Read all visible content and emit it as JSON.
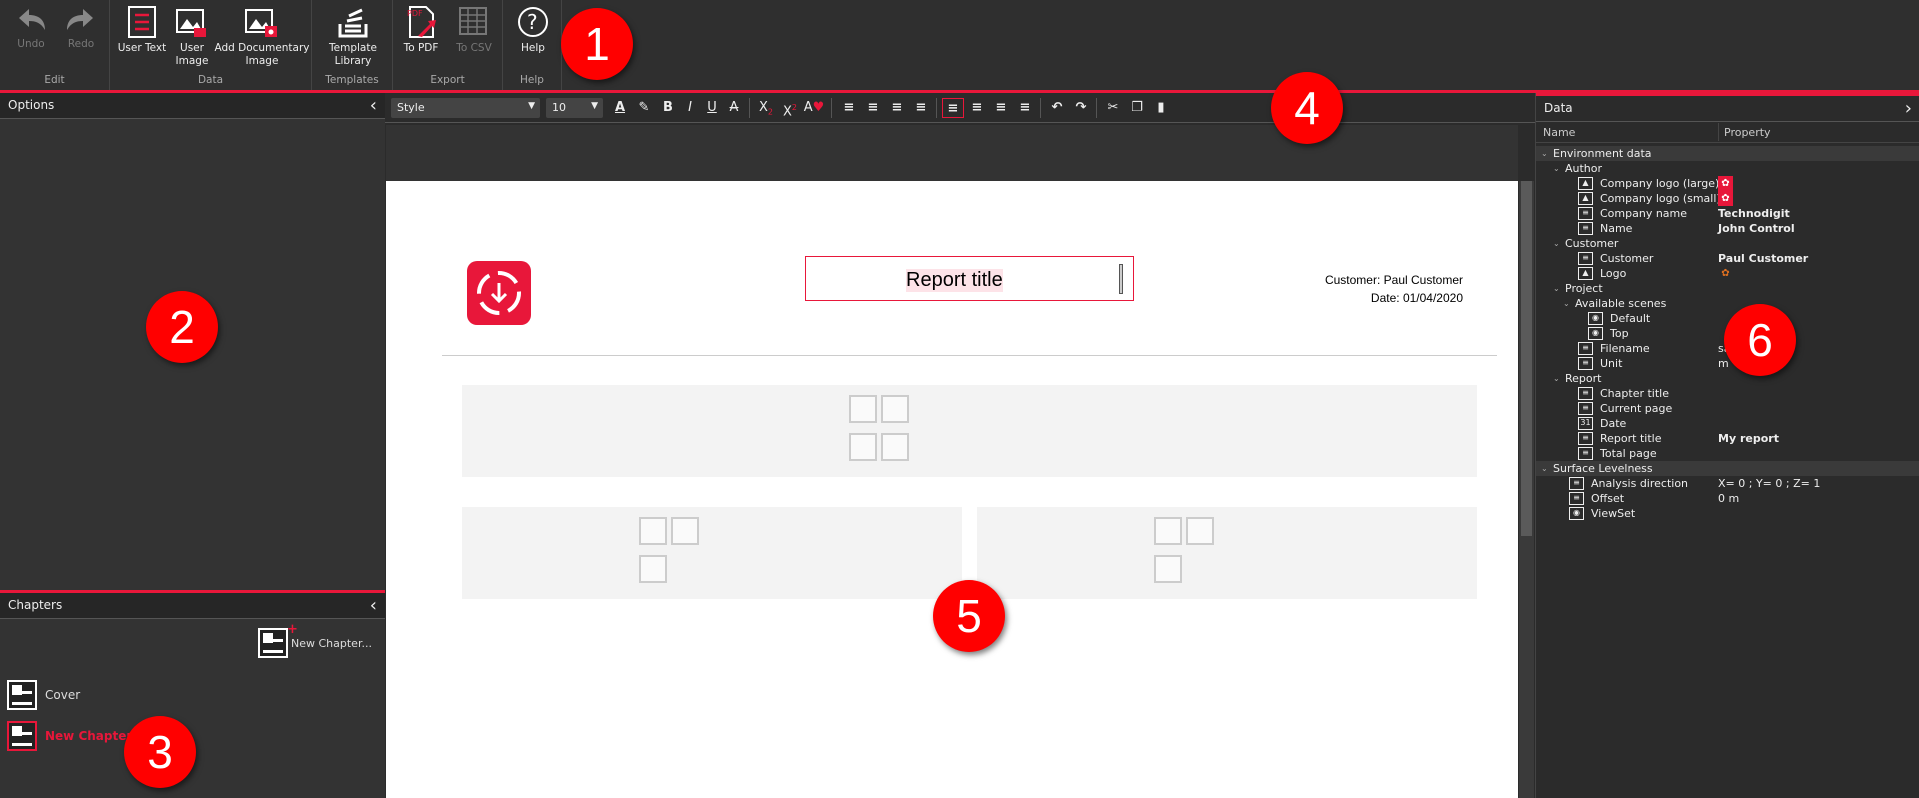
{
  "ribbon": {
    "groups": [
      {
        "label": "Edit",
        "buttons": [
          {
            "label": "Undo",
            "icon": "undo-icon",
            "enabled": false
          },
          {
            "label": "Redo",
            "icon": "redo-icon",
            "enabled": false
          }
        ]
      },
      {
        "label": "Data",
        "buttons": [
          {
            "label": "User Text",
            "icon": "user-text-icon"
          },
          {
            "label": "User Image",
            "icon": "user-image-icon"
          },
          {
            "label": "Add Documentary Image",
            "icon": "documentary-image-icon"
          }
        ]
      },
      {
        "label": "Templates",
        "buttons": [
          {
            "label": "Template Library",
            "icon": "template-library-icon"
          }
        ]
      },
      {
        "label": "Export",
        "buttons": [
          {
            "label": "To PDF",
            "icon": "pdf-icon"
          },
          {
            "label": "To CSV",
            "icon": "csv-icon",
            "enabled": false
          }
        ]
      },
      {
        "label": "Help",
        "buttons": [
          {
            "label": "Help",
            "icon": "help-icon"
          }
        ]
      }
    ]
  },
  "options_panel": {
    "title": "Options"
  },
  "chapters_panel": {
    "title": "Chapters",
    "new_chapter": "New Chapter...",
    "items": [
      {
        "label": "Cover",
        "selected": false
      },
      {
        "label": "New Chapter",
        "selected": true
      }
    ]
  },
  "format_toolbar": {
    "style": "Style",
    "size": "10"
  },
  "page": {
    "report_title": "Report title",
    "customer_line": "Customer: Paul Customer",
    "date_line": "Date: 01/04/2020"
  },
  "data_panel": {
    "title": "Data",
    "col_name": "Name",
    "col_property": "Property",
    "rows": [
      {
        "label": "Environment data",
        "level": 0,
        "group": true
      },
      {
        "label": "Author",
        "level": 1
      },
      {
        "label": "Company logo (large)",
        "level": 2,
        "icon": "image",
        "value_icon": "logo"
      },
      {
        "label": "Company logo (small)",
        "level": 2,
        "icon": "image",
        "value_icon": "logo"
      },
      {
        "label": "Company name",
        "level": 2,
        "icon": "text",
        "value": "Technodigit"
      },
      {
        "label": "Name",
        "level": 2,
        "icon": "text",
        "value": "John Control"
      },
      {
        "label": "Customer",
        "level": 1
      },
      {
        "label": "Customer",
        "level": 2,
        "icon": "text",
        "value": "Paul Customer"
      },
      {
        "label": "Logo",
        "level": 2,
        "icon": "image",
        "value_icon": "customer-logo"
      },
      {
        "label": "Project",
        "level": 1
      },
      {
        "label": "Available scenes",
        "level": 2,
        "expander": true
      },
      {
        "label": "Default",
        "level": 3,
        "icon": "eye"
      },
      {
        "label": "Top",
        "level": 3,
        "icon": "eye"
      },
      {
        "label": "Filename",
        "level": 2,
        "icon": "text",
        "value": "sa",
        "plain": true
      },
      {
        "label": "Unit",
        "level": 2,
        "icon": "text",
        "value": "m",
        "plain": true
      },
      {
        "label": "Report",
        "level": 1
      },
      {
        "label": "Chapter title",
        "level": 2,
        "icon": "text"
      },
      {
        "label": "Current page",
        "level": 2,
        "icon": "text"
      },
      {
        "label": "Date",
        "level": 2,
        "icon": "calendar"
      },
      {
        "label": "Report title",
        "level": 2,
        "icon": "text",
        "value": "My report"
      },
      {
        "label": "Total page",
        "level": 2,
        "icon": "text"
      },
      {
        "label": "Surface Levelness",
        "level": 0,
        "group": true
      },
      {
        "label": "Analysis direction",
        "level": 1.5,
        "icon": "text",
        "value": "X= 0 ; Y= 0 ; Z= 1",
        "plain": true
      },
      {
        "label": "Offset",
        "level": 1.5,
        "icon": "text",
        "value": "0 m",
        "plain": true
      },
      {
        "label": "ViewSet",
        "level": 1.5,
        "icon": "eye"
      }
    ]
  },
  "callouts": [
    "1",
    "2",
    "3",
    "4",
    "5",
    "6"
  ],
  "colors": {
    "accent": "#e8173a",
    "callout": "#ff0000"
  }
}
